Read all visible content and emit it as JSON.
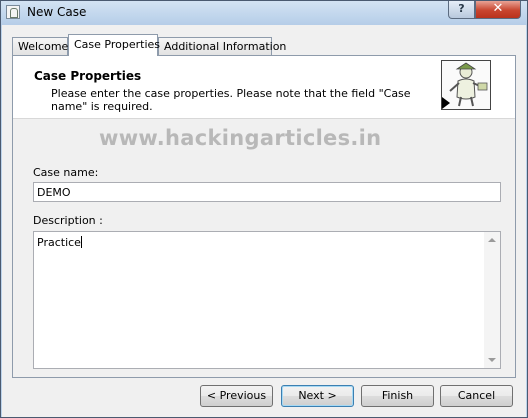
{
  "window": {
    "title": "New Case",
    "help_label": "?",
    "close_label": "✕"
  },
  "tabs": [
    {
      "label": "Welcome",
      "active": false
    },
    {
      "label": "Case Properties",
      "active": true
    },
    {
      "label": "Additional Information",
      "active": false
    }
  ],
  "header": {
    "title": "Case Properties",
    "description": "Please enter the case properties. Please note that the field \"Case name\" is required.",
    "image_icon": "wizard-figure-icon"
  },
  "watermark": "www.hackingarticles.in",
  "form": {
    "case_name_label": "Case name:",
    "case_name_value": "DEMO",
    "description_label": "Description :",
    "description_value": "Practice"
  },
  "buttons": {
    "previous": "< Previous",
    "next": "Next >",
    "finish": "Finish",
    "cancel": "Cancel"
  }
}
